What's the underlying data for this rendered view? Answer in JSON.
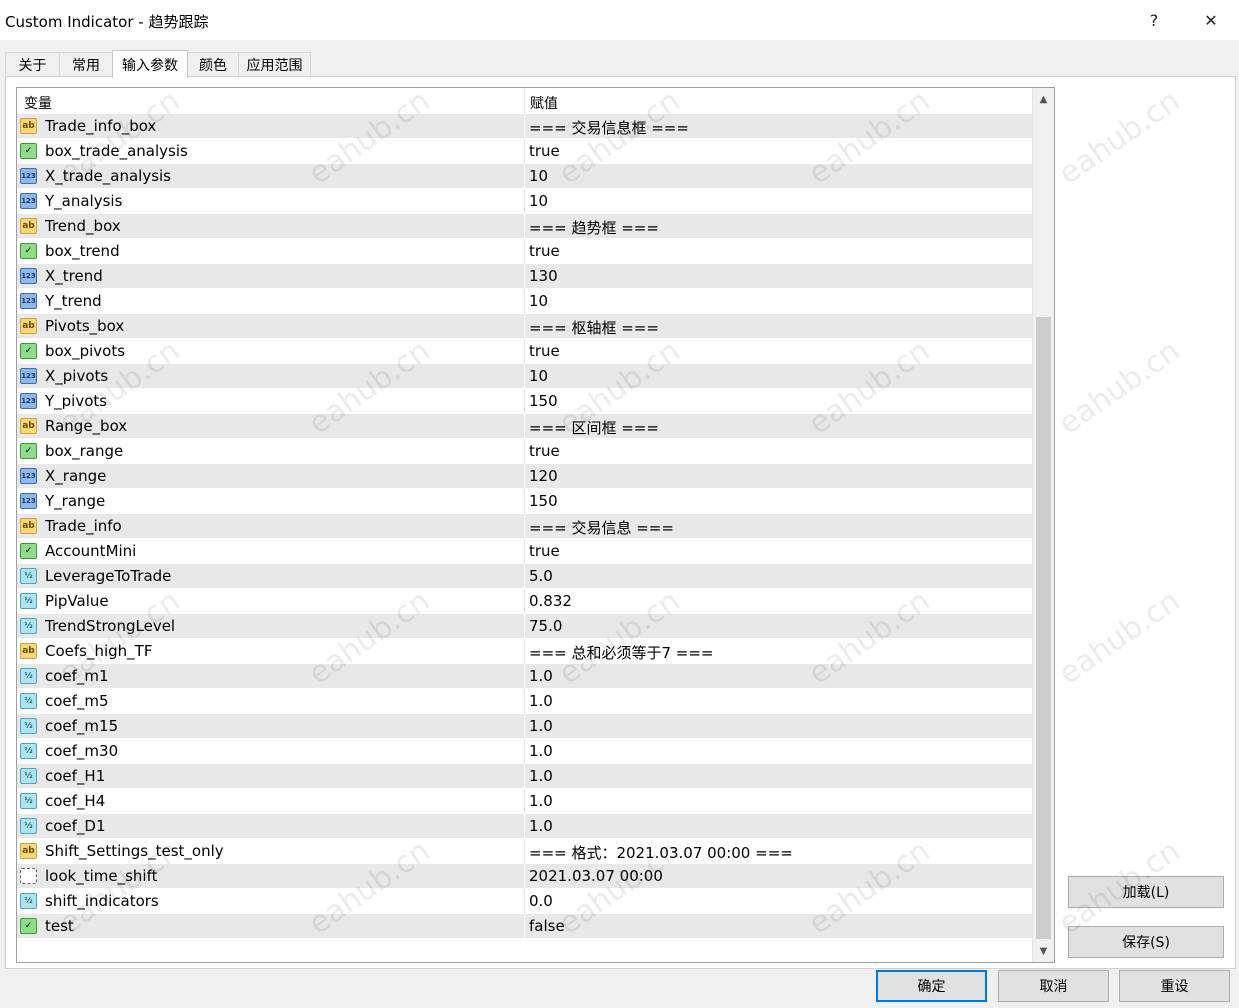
{
  "window": {
    "title": "Custom Indicator - 趋势跟踪",
    "help_label": "?",
    "close_label": "✕"
  },
  "tabs": [
    {
      "label": "关于"
    },
    {
      "label": "常用"
    },
    {
      "label": "输入参数",
      "active": true
    },
    {
      "label": "颜色"
    },
    {
      "label": "应用范围"
    }
  ],
  "grid": {
    "col_variable": "变量",
    "col_value": "赋值",
    "rows": [
      {
        "name": "Trade_info_box",
        "value": "=== 交易信息框 ===",
        "type": "ab"
      },
      {
        "name": "box_trade_analysis",
        "value": "true",
        "type": "bool"
      },
      {
        "name": "X_trade_analysis",
        "value": "10",
        "type": "int"
      },
      {
        "name": "Y_analysis",
        "value": "10",
        "type": "int"
      },
      {
        "name": "Trend_box",
        "value": "=== 趋势框 ===",
        "type": "ab"
      },
      {
        "name": "box_trend",
        "value": "true",
        "type": "bool"
      },
      {
        "name": "X_trend",
        "value": "130",
        "type": "int"
      },
      {
        "name": "Y_trend",
        "value": "10",
        "type": "int"
      },
      {
        "name": "Pivots_box",
        "value": "=== 枢轴框 ===",
        "type": "ab"
      },
      {
        "name": "box_pivots",
        "value": "true",
        "type": "bool"
      },
      {
        "name": "X_pivots",
        "value": "10",
        "type": "int"
      },
      {
        "name": "Y_pivots",
        "value": "150",
        "type": "int"
      },
      {
        "name": "Range_box",
        "value": "=== 区间框 ===",
        "type": "ab"
      },
      {
        "name": "box_range",
        "value": "true",
        "type": "bool"
      },
      {
        "name": "X_range",
        "value": "120",
        "type": "int"
      },
      {
        "name": "Y_range",
        "value": "150",
        "type": "int"
      },
      {
        "name": "Trade_info",
        "value": "=== 交易信息 ===",
        "type": "ab"
      },
      {
        "name": "AccountMini",
        "value": "true",
        "type": "bool"
      },
      {
        "name": "LeverageToTrade",
        "value": "5.0",
        "type": "dbl"
      },
      {
        "name": "PipValue",
        "value": "0.832",
        "type": "dbl"
      },
      {
        "name": "TrendStrongLevel",
        "value": "75.0",
        "type": "dbl"
      },
      {
        "name": "Coefs_high_TF",
        "value": "=== 总和必须等于7 ===",
        "type": "ab"
      },
      {
        "name": "coef_m1",
        "value": "1.0",
        "type": "dbl"
      },
      {
        "name": "coef_m5",
        "value": "1.0",
        "type": "dbl"
      },
      {
        "name": "coef_m15",
        "value": "1.0",
        "type": "dbl"
      },
      {
        "name": "coef_m30",
        "value": "1.0",
        "type": "dbl"
      },
      {
        "name": "coef_H1",
        "value": "1.0",
        "type": "dbl"
      },
      {
        "name": "coef_H4",
        "value": "1.0",
        "type": "dbl"
      },
      {
        "name": "coef_D1",
        "value": "1.0",
        "type": "dbl"
      },
      {
        "name": "Shift_Settings_test_only",
        "value": "=== 格式：2021.03.07 00:00 ===",
        "type": "ab"
      },
      {
        "name": "look_time_shift",
        "value": "2021.03.07 00:00",
        "type": "dt"
      },
      {
        "name": "shift_indicators",
        "value": "0.0",
        "type": "dbl"
      },
      {
        "name": "test",
        "value": "false",
        "type": "bool"
      }
    ]
  },
  "side_buttons": {
    "load_label": "加载(L)",
    "save_label": "保存(S)"
  },
  "bottom_buttons": {
    "ok_label": "确定",
    "cancel_label": "取消",
    "reset_label": "重设"
  },
  "watermark": "eahub.cn",
  "scrollbar": {
    "up_icon": "▲",
    "down_icon": "▼"
  }
}
